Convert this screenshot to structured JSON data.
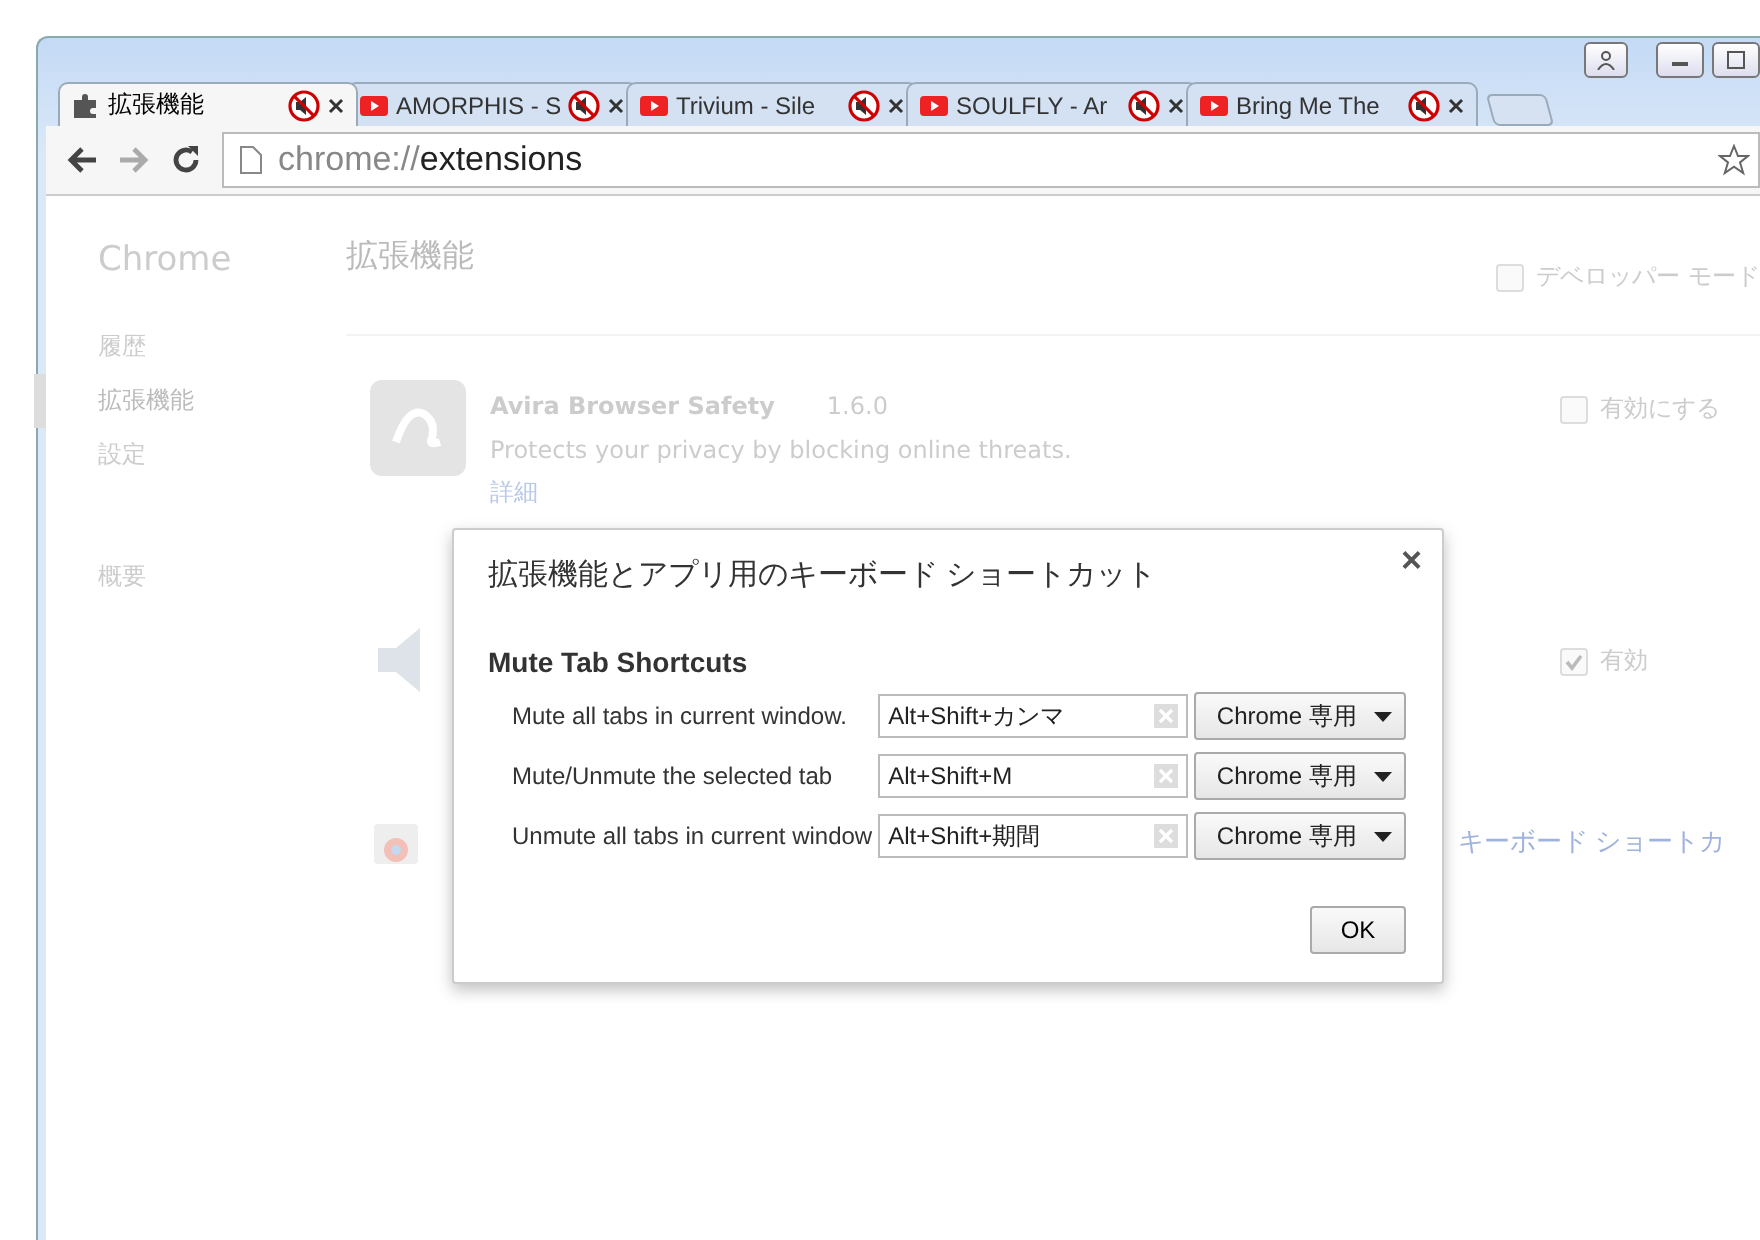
{
  "tabs": [
    {
      "title": "拡張機能",
      "kind": "extension",
      "selected": true
    },
    {
      "title": "AMORPHIS - S",
      "kind": "video",
      "selected": false
    },
    {
      "title": "Trivium - Sile",
      "kind": "video",
      "selected": false
    },
    {
      "title": "SOULFLY - Ar",
      "kind": "video",
      "selected": false
    },
    {
      "title": "Bring Me The",
      "kind": "video",
      "selected": false
    }
  ],
  "address": {
    "scheme": "chrome://",
    "path": "extensions"
  },
  "sidebar": {
    "title": "Chrome",
    "items": [
      {
        "label": "履歴",
        "selected": false
      },
      {
        "label": "拡張機能",
        "selected": true
      },
      {
        "label": "設定",
        "selected": false
      }
    ],
    "about": "概要"
  },
  "page": {
    "title": "拡張機能",
    "developer_mode": {
      "label": "デベロッパー モード",
      "checked": false
    },
    "extensions": [
      {
        "kind": "avira",
        "name": "Avira Browser Safety",
        "version": "1.6.0",
        "description": "Protects your privacy by blocking online threats.",
        "details": "詳細",
        "enable_label": "有効にする",
        "checked": false
      },
      {
        "kind": "speaker",
        "enable_label": "有効",
        "checked": true
      }
    ],
    "shortcuts_link": "キーボード ショートカ"
  },
  "dialog": {
    "title": "拡張機能とアプリ用のキーボード ショートカット",
    "close": "×",
    "section": "Mute Tab Shortcuts",
    "rows": [
      {
        "label": "Mute all tabs in current window.",
        "value": "Alt+Shift+カンマ",
        "scope": "Chrome 専用"
      },
      {
        "label": "Mute/Unmute the selected tab",
        "value": "Alt+Shift+M",
        "scope": "Chrome 専用"
      },
      {
        "label": "Unmute all tabs in current window",
        "value": "Alt+Shift+期間",
        "scope": "Chrome 専用"
      }
    ],
    "ok": "OK"
  }
}
